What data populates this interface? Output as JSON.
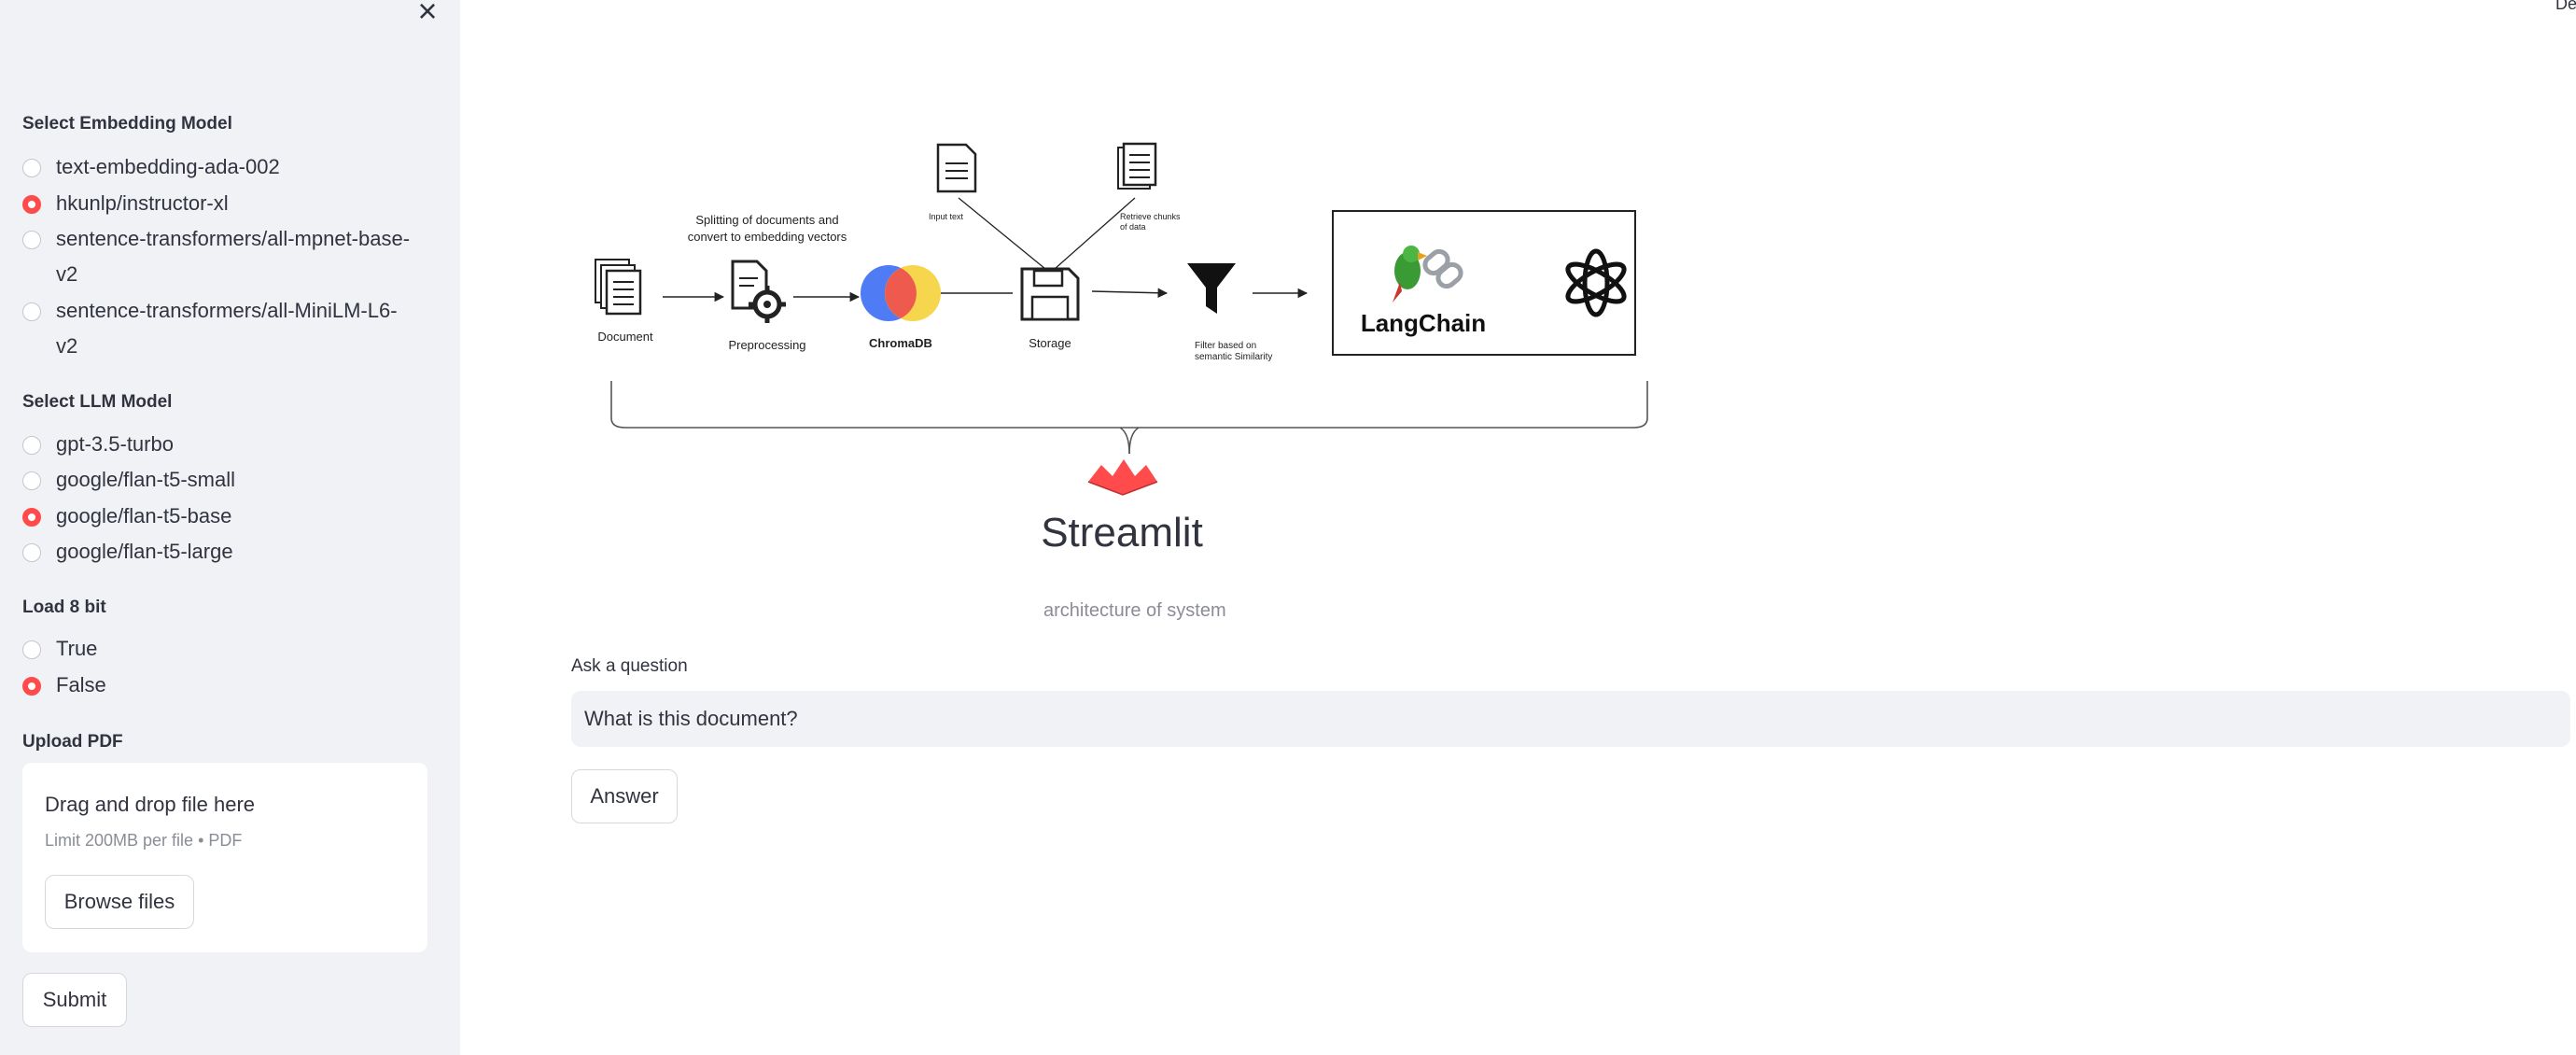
{
  "sidebar": {
    "embedding": {
      "label": "Select Embedding Model",
      "options": [
        {
          "text": "text-embedding-ada-002",
          "selected": false
        },
        {
          "text": "hkunlp/instructor-xl",
          "selected": true
        },
        {
          "text": "sentence-transformers/all-mpnet-base-v2",
          "selected": false
        },
        {
          "text": "sentence-transformers/all-MiniLM-L6-v2",
          "selected": false
        }
      ]
    },
    "llm": {
      "label": "Select LLM Model",
      "options": [
        {
          "text": "gpt-3.5-turbo",
          "selected": false
        },
        {
          "text": "google/flan-t5-small",
          "selected": false
        },
        {
          "text": "google/flan-t5-base",
          "selected": true
        },
        {
          "text": "google/flan-t5-large",
          "selected": false
        }
      ]
    },
    "load8bit": {
      "label": "Load 8 bit",
      "options": [
        {
          "text": "True",
          "selected": false
        },
        {
          "text": "False",
          "selected": true
        }
      ]
    },
    "upload": {
      "label": "Upload PDF",
      "title": "Drag and drop file here",
      "limit": "Limit 200MB per file • PDF",
      "browse_label": "Browse files"
    },
    "submit_label": "Submit",
    "close_icon": "×"
  },
  "header": {
    "deploy_label": "De"
  },
  "diagram": {
    "top_caption": [
      "Splitting of documents and",
      "convert to embedding vectors"
    ],
    "input_text": "Input text",
    "retrieve": [
      "Retrieve chunks",
      "of data"
    ],
    "document": "Document",
    "preprocessing": "Preprocessing",
    "chromadb": "ChromaDB",
    "storage": "Storage",
    "filter": [
      "Filter based on",
      "semantic Similarity"
    ],
    "langchain": "LangChain",
    "streamlit": "Streamlit",
    "colors": {
      "chroma_blue": "#4f7cf5",
      "chroma_red": "#ef5a4e",
      "chroma_yellow": "#f5d443",
      "streamlit_red": "#ff4b4b"
    }
  },
  "main": {
    "caption": "architecture of system",
    "question_label": "Ask a question",
    "question_value": "What is this document?",
    "answer_label": "Answer"
  },
  "accent": "#ff4b4b"
}
